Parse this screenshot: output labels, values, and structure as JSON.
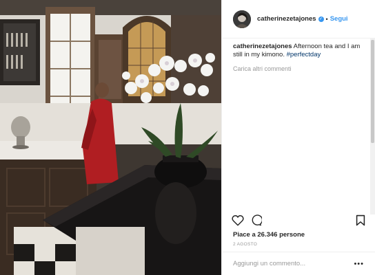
{
  "header": {
    "username": "catherinezetajones",
    "verified_glyph": "✓",
    "separator": "•",
    "follow_label": "Segui"
  },
  "caption": {
    "username": "catherinezetajones",
    "text": " Afternoon tea and I am still in my kimono. ",
    "hashtag": "#perfectday"
  },
  "load_more_label": "Carica altri commenti",
  "actions": {
    "like_icon": "heart-icon",
    "comment_icon": "comment-icon",
    "save_icon": "bookmark-icon"
  },
  "likes_label": "Piace a 26.346 persone",
  "date_label": "2 AGOSTO",
  "comment_input": {
    "placeholder": "Aggiungi un commento..."
  },
  "options_label": "•••",
  "colors": {
    "link": "#3897f0",
    "hashtag": "#003569",
    "muted": "#999999",
    "text": "#262626"
  }
}
